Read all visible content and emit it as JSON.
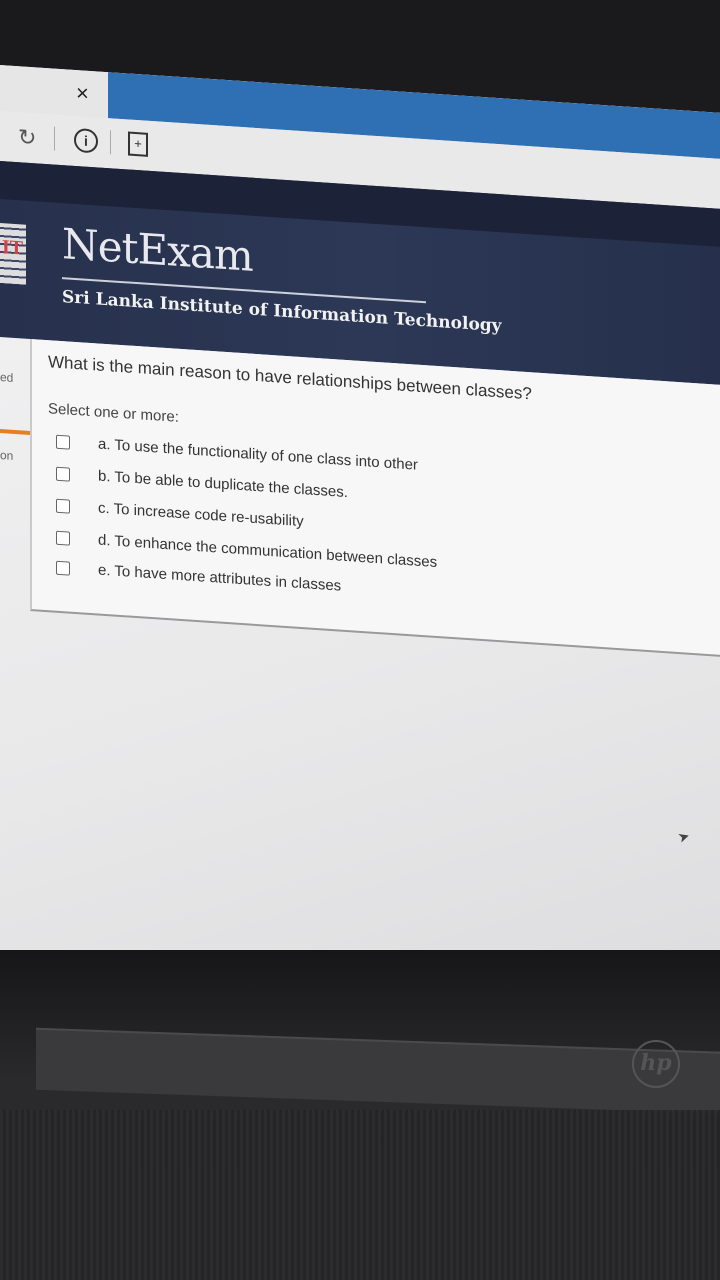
{
  "browser": {
    "close_glyph": "×",
    "reload_glyph": "↻",
    "info_glyph": "i",
    "page_glyph": "+"
  },
  "header": {
    "logo_letters": "IT",
    "brand": "NetExam",
    "institute": "Sri Lanka Institute of Information Technology"
  },
  "side_labels": [
    "ed",
    "on"
  ],
  "question": {
    "text": "What is the main reason to have relationships between classes?",
    "prompt": "Select one or more:",
    "options": [
      {
        "label": "a. To use the functionality of one class into other",
        "checked": false
      },
      {
        "label": "b. To be able to duplicate the classes.",
        "checked": false
      },
      {
        "label": "c. To increase code re-usability",
        "checked": false
      },
      {
        "label": "d. To enhance the communication between classes",
        "checked": false
      },
      {
        "label": "e. To have more attributes in classes",
        "checked": false
      }
    ]
  },
  "device": {
    "brand_mark": "hp"
  }
}
